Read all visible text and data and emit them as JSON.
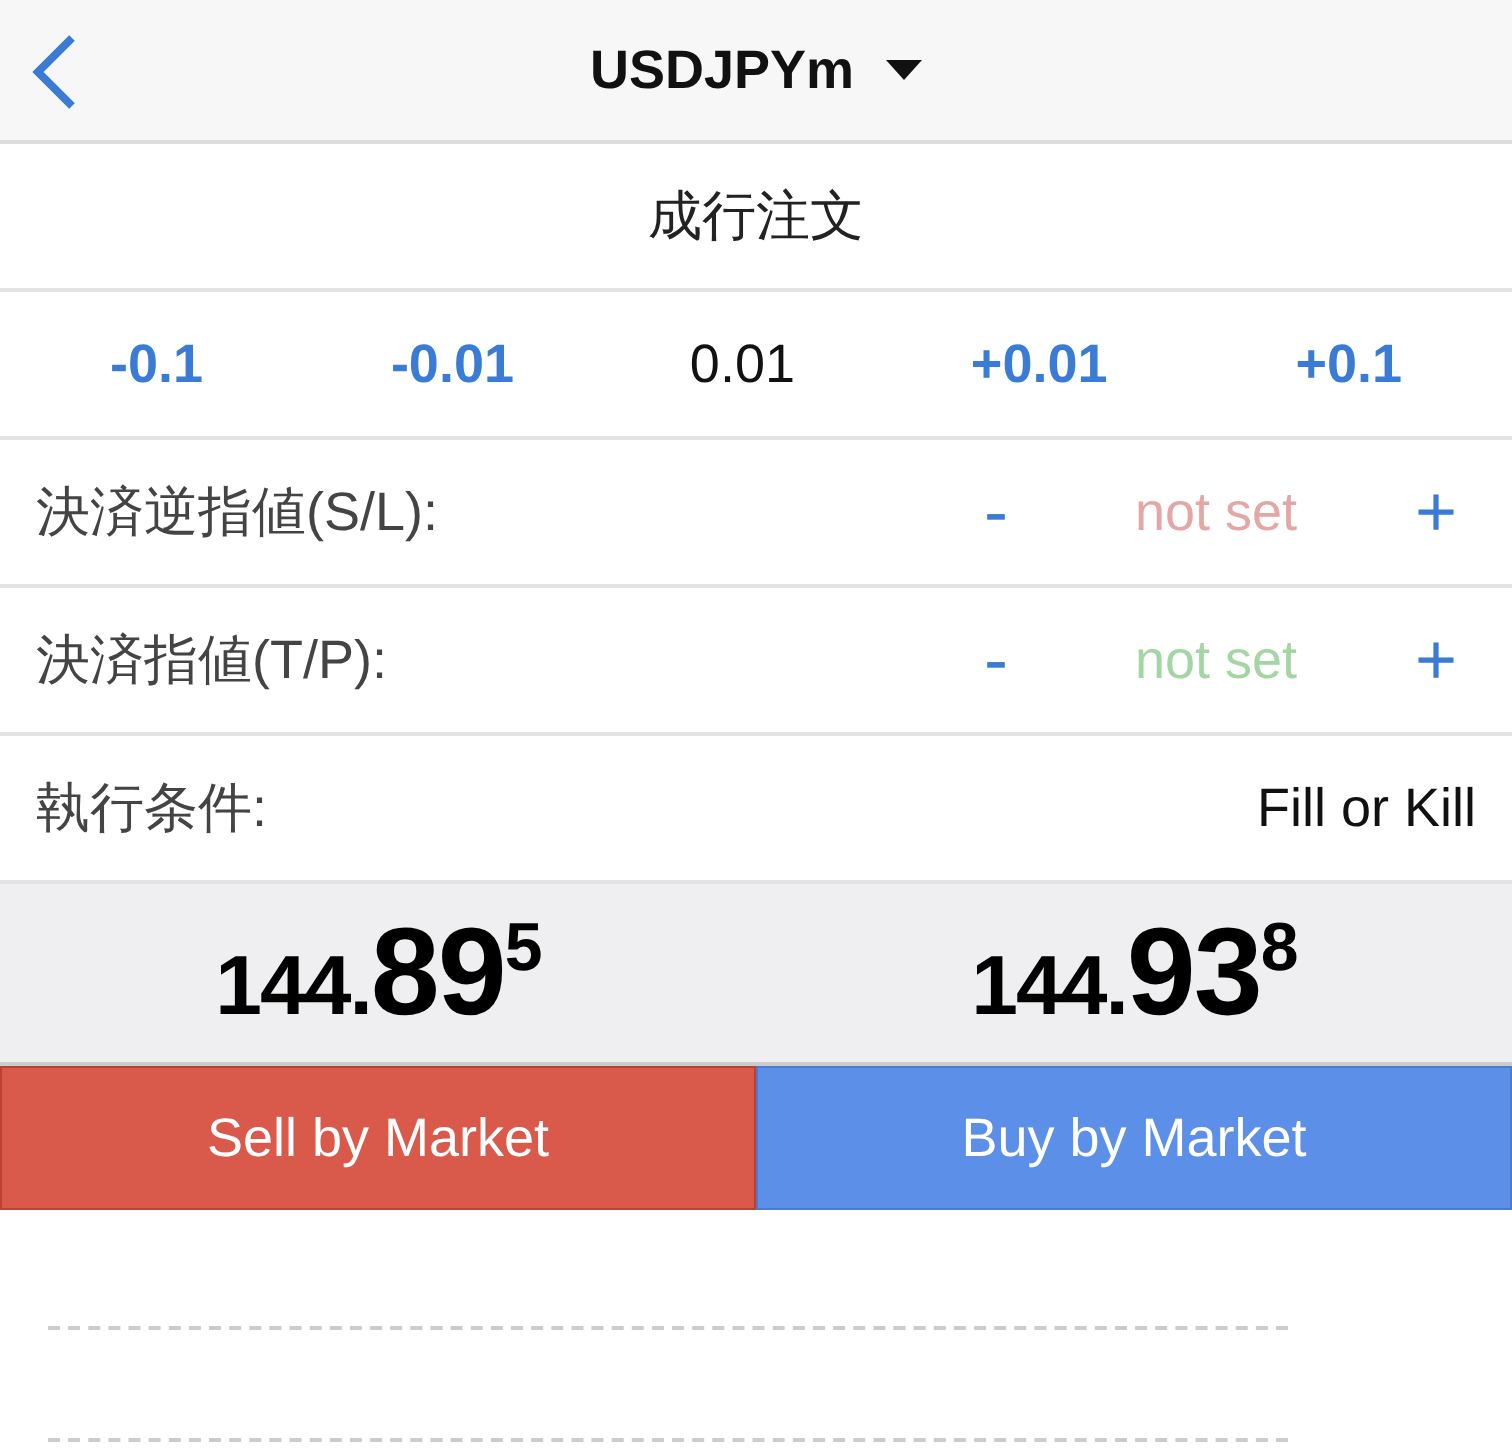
{
  "header": {
    "symbol": "USDJPYm"
  },
  "order_type": "成行注文",
  "volume": [
    {
      "label": "-0.1",
      "kind": "step"
    },
    {
      "label": "-0.01",
      "kind": "step"
    },
    {
      "label": "0.01",
      "kind": "value"
    },
    {
      "label": "+0.01",
      "kind": "step"
    },
    {
      "label": "+0.1",
      "kind": "step"
    }
  ],
  "levels": [
    {
      "label": "決済逆指値(S/L):",
      "minus": "-",
      "value": "not set",
      "plus": "+",
      "color": "#e3a8a6"
    },
    {
      "label": "決済指値(T/P):",
      "minus": "-",
      "value": "not set",
      "plus": "+",
      "color": "#a3d6a3"
    }
  ],
  "fill_policy": {
    "label": "執行条件:",
    "value": "Fill or Kill"
  },
  "prices": [
    {
      "lead": "144.",
      "big": "89",
      "sup": "5"
    },
    {
      "lead": "144.",
      "big": "93",
      "sup": "8"
    }
  ],
  "buttons": [
    {
      "label": "Sell by Market",
      "kind": "sell"
    },
    {
      "label": "Buy by Market",
      "kind": "buy"
    }
  ]
}
